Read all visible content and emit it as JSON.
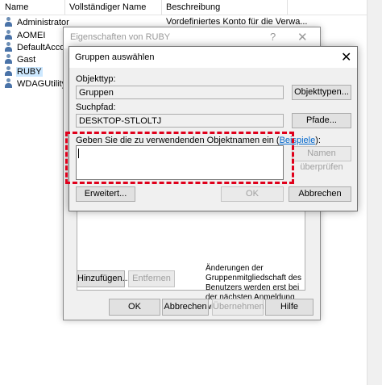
{
  "list": {
    "columns": [
      "Name",
      "Vollständiger Name",
      "Beschreibung"
    ],
    "users": [
      {
        "name": "Administrator",
        "description": "Vordefiniertes Konto für die Verwa..."
      },
      {
        "name": "AOMEI",
        "description": ""
      },
      {
        "name": "DefaultAcco...",
        "description": ""
      },
      {
        "name": "Gast",
        "description": ""
      },
      {
        "name": "RUBY",
        "description": ""
      },
      {
        "name": "WDAGUtility...",
        "description": ""
      }
    ]
  },
  "properties": {
    "title": "Eigenschaften von RUBY",
    "help_glyph": "?",
    "close_glyph": "✕",
    "add_label": "Hinzufügen...",
    "remove_label": "Entfernen",
    "note": "Änderungen der Gruppenmitgliedschaft des Benutzers werden erst bei der nächsten Anmeldung wirksam.",
    "ok_label": "OK",
    "cancel_label": "Abbrechen",
    "apply_label": "Übernehmen",
    "help_label": "Hilfe"
  },
  "dialog": {
    "title": "Gruppen auswählen",
    "close_glyph": "✕",
    "object_type_label": "Objekttyp:",
    "object_type_value": "Gruppen",
    "object_types_button": "Objekttypen...",
    "search_path_label": "Suchpfad:",
    "search_path_value": "DESKTOP-STLOLTJ",
    "paths_button": "Pfade...",
    "names_prompt": "Geben Sie die zu verwendenden Objektnamen ein (",
    "examples_link": "Beispiele",
    "names_prompt_end": "):",
    "names_value": "",
    "check_names_button": "Namen überprüfen",
    "advanced_button": "Erweitert...",
    "ok_button": "OK",
    "cancel_button": "Abbrechen"
  },
  "colors": {
    "highlight": "#e0001b",
    "selected_row": "#cce8ff",
    "link": "#0066cc"
  }
}
